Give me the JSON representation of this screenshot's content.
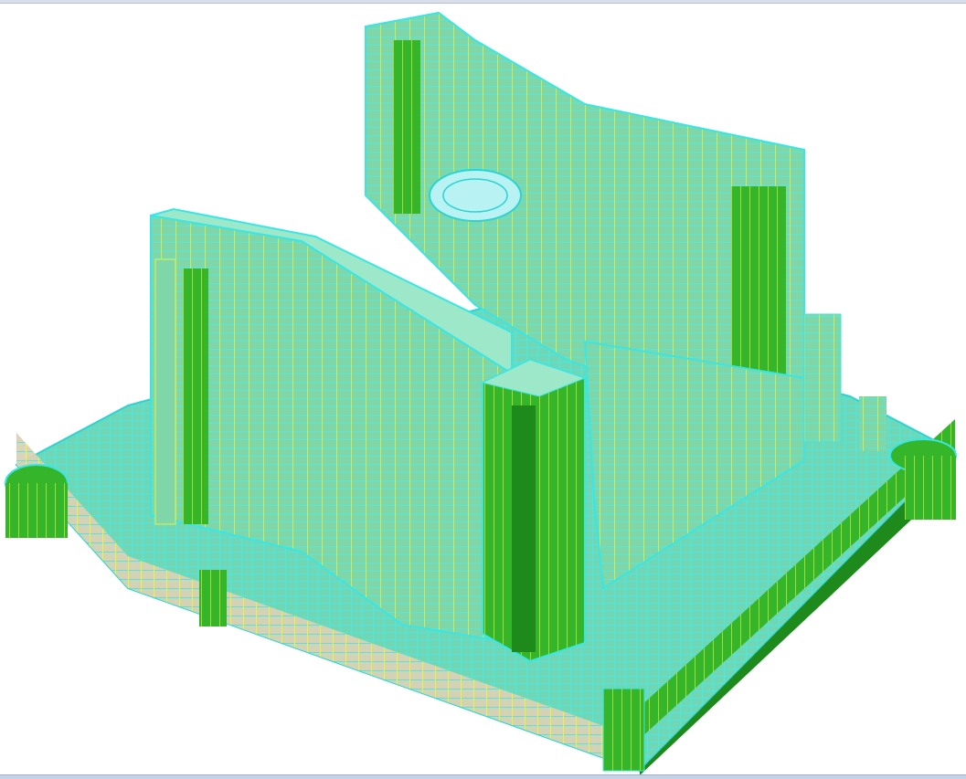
{
  "viewport": {
    "kind": "3d-structural-model",
    "palette": {
      "beam": "#39e6e6",
      "column": "#ffff33",
      "shear_wall": "#35b52a",
      "wall_dark": "#1e8a1b",
      "slab": "#c8c0a0",
      "background": "#ffffff"
    }
  }
}
